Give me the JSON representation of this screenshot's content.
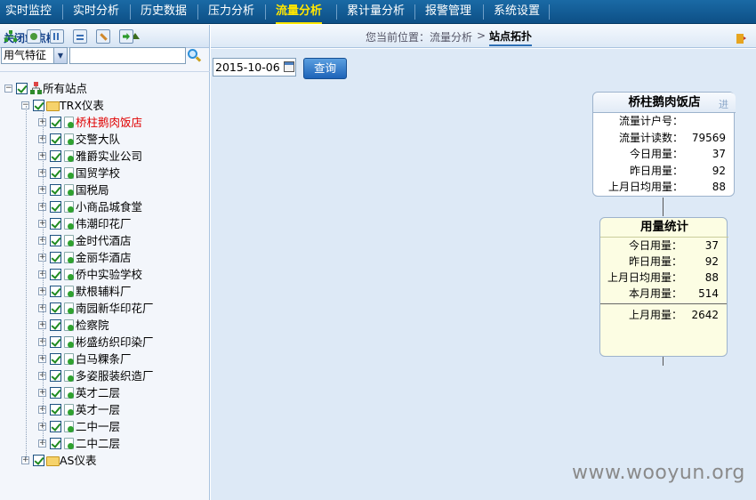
{
  "nav": {
    "items": [
      "实时监控",
      "实时分析",
      "历史数据",
      "压力分析",
      "流量分析",
      "累计量分析",
      "报警管理",
      "系统设置"
    ],
    "active_index": 4
  },
  "sidebar": {
    "title": "关闭站点树",
    "filter_select": "用气特征",
    "filter_input": "",
    "tree": {
      "root": "所有站点",
      "groups": [
        {
          "label": "TRX仪表",
          "items": [
            "桥柱鹅肉饭店",
            "交警大队",
            "雅爵实业公司",
            "国贸学校",
            "国税局",
            "小商品城食堂",
            "伟潮印花厂",
            "金时代酒店",
            "金丽华酒店",
            "侨中实验学校",
            "默根辅料厂",
            "南园新华印花厂",
            "检察院",
            "彬盛纺织印染厂",
            "白马粿条厂",
            "多姿服装织造厂",
            "英才二层",
            "英才一层",
            "二中一层",
            "二中二层"
          ],
          "selected_index": 0
        },
        {
          "label": "AS仪表",
          "items": []
        }
      ]
    }
  },
  "breadcrumb": {
    "prefix": "您当前位置：流量分析",
    "separator": ">",
    "current": "站点拓扑"
  },
  "query": {
    "date": "2015-10-06",
    "button": "查询"
  },
  "station_card": {
    "title": "桥柱鹅肉饭店",
    "enter": "进",
    "rows": [
      {
        "label": "流量计户号：",
        "value": ""
      },
      {
        "label": "流量计读数：",
        "value": "79569"
      },
      {
        "label": "今日用量：",
        "value": "37"
      },
      {
        "label": "昨日用量：",
        "value": "92"
      },
      {
        "label": "上月日均用量：",
        "value": "88"
      }
    ]
  },
  "stats_card": {
    "title": "用量统计",
    "rows": [
      {
        "label": "今日用量：",
        "value": "37"
      },
      {
        "label": "昨日用量：",
        "value": "92"
      },
      {
        "label": "上月日均用量：",
        "value": "88"
      },
      {
        "label": "本月用量：",
        "value": "514"
      },
      {
        "label": "上月用量：",
        "value": "2642"
      }
    ]
  },
  "watermark": "www.wooyun.org",
  "colors": {
    "nav_bg": "#0d4f86",
    "nav_active": "#ffe600",
    "selected_item": "#e00000",
    "main_bg": "#dde9f6",
    "stats_bg": "#fcfde3"
  }
}
